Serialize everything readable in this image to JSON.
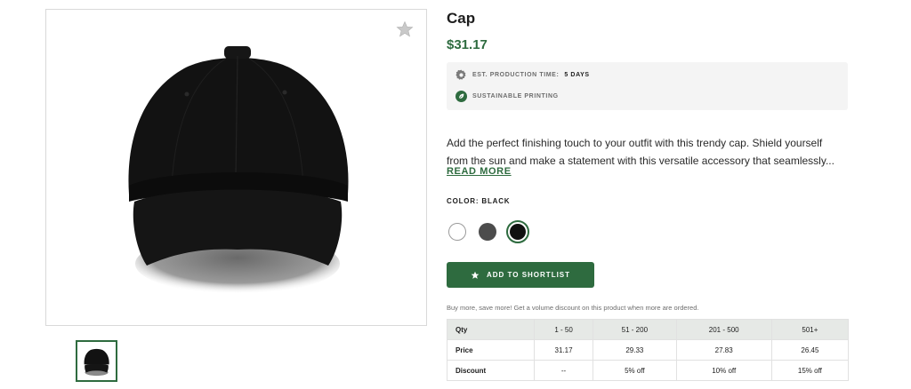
{
  "product": {
    "title": "Cap",
    "price": "$31.17",
    "production_label": "EST. PRODUCTION TIME:",
    "production_value": "5 DAYS",
    "sustainable_label": "SUSTAINABLE PRINTING",
    "description_line1": "Add the perfect finishing touch to your outfit with this trendy cap. Shield yourself",
    "description_line2": "from the sun and make a statement with this versatile accessory that seamlessly...",
    "read_more": "READ MORE",
    "color_label": "COLOR: BLACK",
    "colors": [
      "#ffffff",
      "#4c4c4c",
      "#111111"
    ],
    "selected_color": "#111111",
    "shortlist_button": "ADD TO SHORTLIST",
    "volume_note": "Buy more, save more! Get a volume discount on this product when more are ordered."
  },
  "pricing": {
    "headers": [
      "Qty",
      "1 - 50",
      "51 - 200",
      "201 - 500",
      "501+"
    ],
    "rows": [
      [
        "Price",
        "31.17",
        "29.33",
        "27.83",
        "26.45"
      ],
      [
        "Discount",
        "--",
        "5% off",
        "10% off",
        "15% off"
      ]
    ]
  },
  "icons": {
    "favorite": "star-icon",
    "production": "gear-icon",
    "sustainable": "leaf-icon",
    "shortlist": "star-icon"
  },
  "colors": {
    "accent": "#2e6b3f",
    "panel": "#f4f4f4",
    "table_header": "#e6e9e6"
  }
}
